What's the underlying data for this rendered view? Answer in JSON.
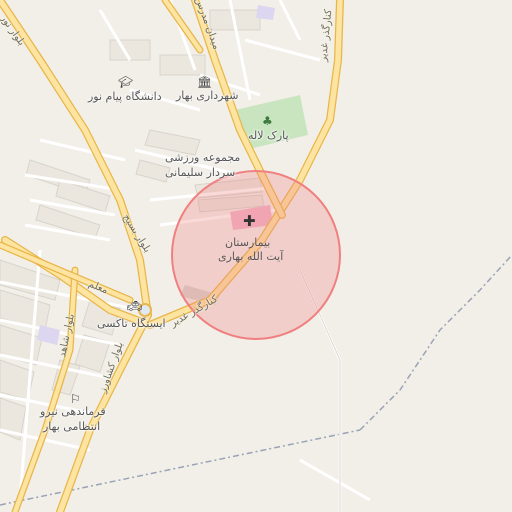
{
  "map": {
    "highlight_color": "#f08080",
    "road_primary_color": "#f5c86a",
    "road_fill_color": "#fde4a0",
    "park_color": "#c9e5c0",
    "boundary_color": "#9aa3b5"
  },
  "roads": {
    "ghadir_east": "کنارگذر غدیر",
    "ghadir_main": "کنارگذر غدیر",
    "basij": "بلوار بسیج",
    "north_left": "بلوار نور",
    "shahed": "بلوار شاهد",
    "keshavarz": "بلوار کشاورز",
    "moallem": "معلم",
    "top_center": "میدان مدرس"
  },
  "places": {
    "university": {
      "name": "دانشگاه پیام نور",
      "icon": "university-icon"
    },
    "municipality": {
      "name": "شهرداری بهار",
      "icon": "municipality-icon"
    },
    "park": {
      "name": "پارک لاله",
      "icon": "tree-icon"
    },
    "sports_line1": "مجموعه ورزشی",
    "sports_line2": "سردار سلیمانی",
    "hospital_line1": "بیمارستان",
    "hospital_line2": "آیت الله بهاری",
    "hospital_icon": "hospital-cross-icon",
    "taxi": {
      "name": "ایستگاه تاکسی",
      "icon": "taxi-icon"
    },
    "police_line1": "فرماندهی نیرو",
    "police_line2": "انتظامی بهار",
    "police_icon": "police-icon"
  }
}
